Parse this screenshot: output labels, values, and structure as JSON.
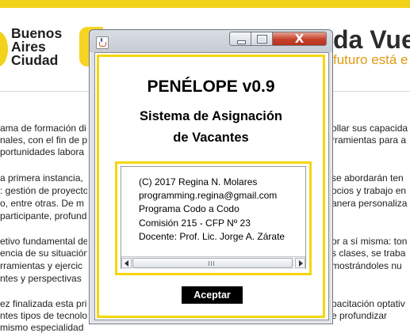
{
  "background_page": {
    "logo": {
      "lines": [
        "Buenos",
        "Aires",
        "Ciudad"
      ]
    },
    "hero": {
      "title": "da Vue",
      "subtitle": "futuro está e"
    },
    "left_lines": [
      "ama de formación di",
      "nales, con el fin de p",
      "portunidades labora",
      "a primera instancia,",
      ": gestión de proyecto",
      "o, entre otras. De m",
      "participante, profund",
      "etivo fundamental de",
      "encia de su situación",
      "rramientas y ejercic",
      "ntes y perspectivas",
      "ez finalizada esta pri",
      "ntes tipos de tecnolo",
      "mismo especialidad"
    ],
    "right_lines": [
      "ollar sus capacida",
      "rramientas para a",
      "se abordarán ten",
      "ocios y trabajo en",
      "anera personaliza",
      "or a sí misma: ton",
      "s clases, se traba",
      "mostrándoles nu",
      "pacitación optativ",
      "e profundizar"
    ]
  },
  "dialog": {
    "window_title": "",
    "close_symbol": "X",
    "app_name": "PENÉLOPE v0.9",
    "subtitle_line1": "Sistema de Asignación",
    "subtitle_line2": "de Vacantes",
    "info_lines": [
      "(C) 2017  Regina N. Molares",
      "programming.regina@gmail.com",
      "Programa Codo a Codo",
      "Comisión 215 - CFP Nº 23",
      "Docente: Prof. Lic. Jorge A. Zárate"
    ],
    "accept_label": "Aceptar"
  },
  "colors": {
    "accent_yellow": "#f5d60c",
    "close_button_red": "#c7402a",
    "accept_button_bg": "#000000"
  },
  "icons": [
    "java-cup-icon",
    "minimize-icon",
    "maximize-icon",
    "close-icon",
    "scroll-left-arrow-icon",
    "scroll-right-arrow-icon",
    "scroll-grip-icon"
  ]
}
